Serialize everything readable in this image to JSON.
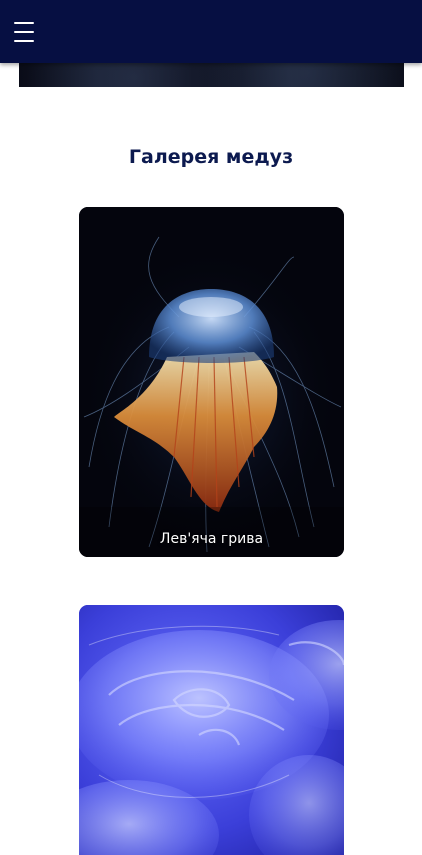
{
  "header": {
    "menu_icon": "hamburger-menu-icon",
    "background_color": "#060f42"
  },
  "gallery": {
    "title": "Галерея медуз",
    "items": [
      {
        "caption": "Лев'яча грива"
      },
      {
        "caption": ""
      }
    ]
  }
}
